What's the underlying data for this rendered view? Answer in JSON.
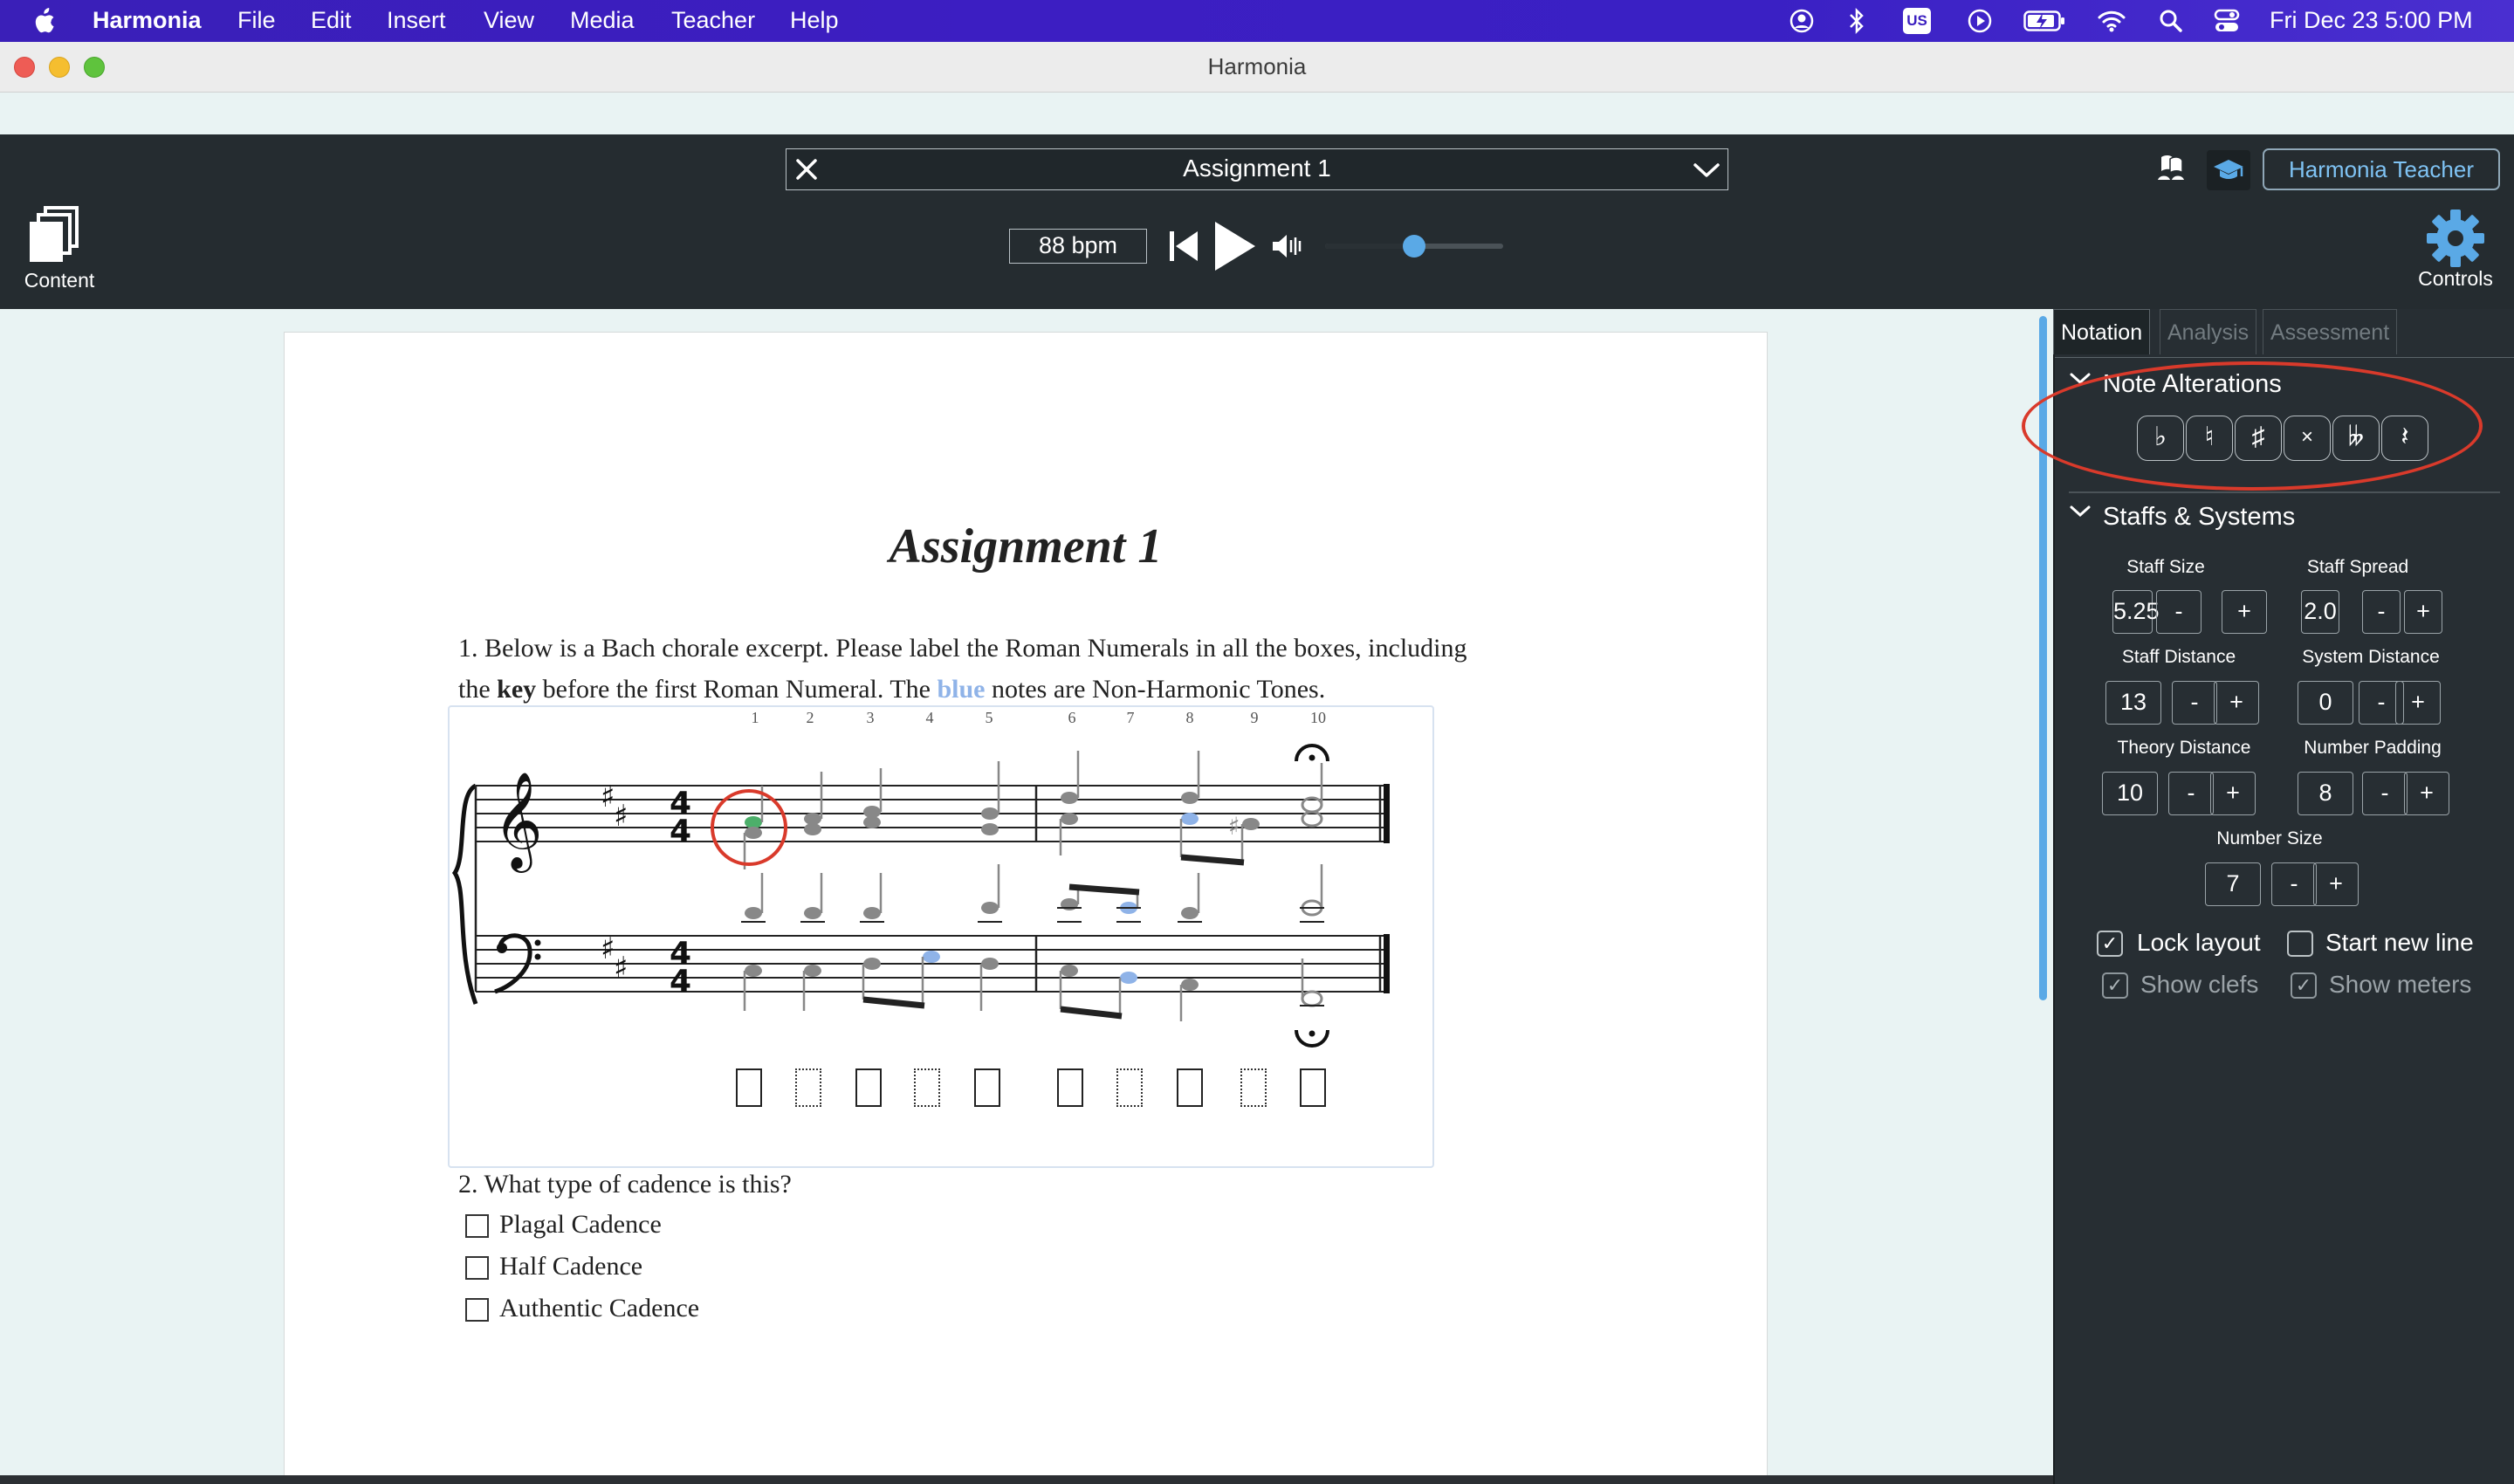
{
  "menubar": {
    "app_name": "Harmonia",
    "items": [
      "File",
      "Edit",
      "Insert",
      "View",
      "Media",
      "Teacher",
      "Help"
    ],
    "keyboard_layout": "US",
    "datetime": "Fri Dec 23  5:00 PM"
  },
  "window": {
    "title": "Harmonia"
  },
  "toolbar": {
    "content_label": "Content",
    "assignment_title": "Assignment 1",
    "tempo": "88 bpm",
    "volume": 0.5,
    "teacher_button": "Harmonia Teacher",
    "controls_label": "Controls"
  },
  "document": {
    "title": "Assignment 1",
    "q1_line1": "1. Below is a Bach chorale excerpt. Please label the Roman Numerals in all the boxes, including",
    "q1_the": "the",
    "q1_key": "key",
    "q1_mid": "before the first Roman Numeral. The",
    "q1_blue": "blue",
    "q1_end": "notes are Non-Harmonic Tones.",
    "beat_numbers": [
      "1",
      "2",
      "3",
      "4",
      "5",
      "6",
      "7",
      "8",
      "9",
      "10"
    ],
    "q2": "2. What type of cadence is this?",
    "options": [
      "Plagal Cadence",
      "Half Cadence",
      "Authentic Cadence"
    ]
  },
  "panel": {
    "tabs": [
      "Notation",
      "Analysis",
      "Assessment"
    ],
    "active_tab": "Notation",
    "note_alterations": {
      "title": "Note Alterations",
      "buttons": [
        "♭",
        "♮",
        "♯",
        "×",
        "𝄫",
        "𝄽"
      ]
    },
    "staffs_systems": {
      "title": "Staffs & Systems",
      "staff_size": {
        "label": "Staff Size",
        "value": "5.25"
      },
      "staff_spread": {
        "label": "Staff Spread",
        "value": "2.0"
      },
      "staff_distance": {
        "label": "Staff Distance",
        "value": "13"
      },
      "system_distance": {
        "label": "System Distance",
        "value": "0"
      },
      "theory_distance": {
        "label": "Theory Distance",
        "value": "10"
      },
      "number_padding": {
        "label": "Number Padding",
        "value": "8"
      },
      "number_size": {
        "label": "Number Size",
        "value": "7"
      },
      "minus": "-",
      "plus": "+",
      "lock_layout": {
        "label": "Lock layout",
        "checked": true
      },
      "start_new_line": {
        "label": "Start new line",
        "checked": false
      },
      "show_clefs": {
        "label": "Show clefs",
        "checked": true
      },
      "show_meters": {
        "label": "Show meters",
        "checked": true
      }
    }
  },
  "colors": {
    "menubar": "#3b1fc0",
    "toolbar": "#252c30",
    "panel": "#272e33",
    "accent_blue": "#5aa9e6",
    "annotation_red": "#d93a2b",
    "nonharmonic_blue": "#8fb3e8",
    "selected_note_green": "#4caf6a"
  }
}
